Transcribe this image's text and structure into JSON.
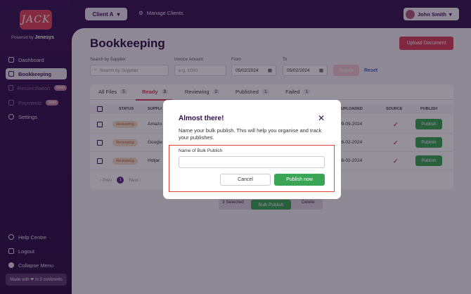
{
  "brand": {
    "logo_text": "JACK",
    "powered_prefix": "Powered by",
    "powered_brand": "Jenesys"
  },
  "sidebar": {
    "items": [
      {
        "label": "Dashboard",
        "icon": "grid-icon"
      },
      {
        "label": "Bookkeeping",
        "icon": "book-icon"
      },
      {
        "label": "Reconciliation",
        "icon": "reconcile-icon",
        "badge": "Soon"
      },
      {
        "label": "Payments",
        "icon": "payment-icon",
        "badge": "Soon"
      },
      {
        "label": "Settings",
        "icon": "gear-icon"
      }
    ],
    "bottom": [
      {
        "label": "Help Centre",
        "icon": "help-icon"
      },
      {
        "label": "Logout",
        "icon": "logout-icon"
      },
      {
        "label": "Collapse Menu",
        "icon": "collapse-icon"
      }
    ],
    "made_with": "Made with ❤ in 3 continents"
  },
  "topbar": {
    "client": "Client A",
    "manage": "Manage Clients",
    "user": "John Smith"
  },
  "page": {
    "title": "Bookkeeping",
    "upload": "Upload Document"
  },
  "filters": {
    "supplier_label": "Search by Supplier",
    "supplier_placeholder": "Search by Supplier",
    "amount_label": "Invoice Amount",
    "amount_placeholder": "e.g. 1000",
    "from_label": "From",
    "from_value": "05/02/2024",
    "to_label": "To",
    "to_value": "05/02/2024",
    "search": "Search",
    "reset": "Reset"
  },
  "tabs": [
    {
      "label": "All Files",
      "count": "5"
    },
    {
      "label": "Ready",
      "count": "3"
    },
    {
      "label": "Reviewing",
      "count": "2"
    },
    {
      "label": "Published",
      "count": "1"
    },
    {
      "label": "Failed",
      "count": "1"
    }
  ],
  "table": {
    "headers": {
      "status": "STATUS",
      "supplier": "SUPPLI",
      "uploaded": "UPLOADED",
      "source": "SOURCE",
      "publish": "PUBLISH"
    },
    "rows": [
      {
        "status": "Reviewing",
        "supplier": "Amazo",
        "uploaded": "09-09-2024",
        "action": "Publish"
      },
      {
        "status": "Reviewing",
        "supplier": "Google",
        "uploaded": "26-02-2024",
        "action": "Publish"
      },
      {
        "status": "Reviewing",
        "supplier": "Hotjar",
        "uploaded": "26-02-2024",
        "action": "Publish"
      }
    ],
    "pager": {
      "prev": "Prev",
      "page": "1",
      "next": "Next"
    }
  },
  "bulkbar": {
    "selected": "3 Selected",
    "bulk": "Bulk Publish",
    "delete": "Delete"
  },
  "modal": {
    "title": "Almost there!",
    "close": "✕",
    "description": "Name your bulk publish. This will help you organise and track your publishes.",
    "field_label": "Name of Bulk Publish",
    "field_value": "",
    "cancel": "Cancel",
    "confirm": "Publish now"
  }
}
